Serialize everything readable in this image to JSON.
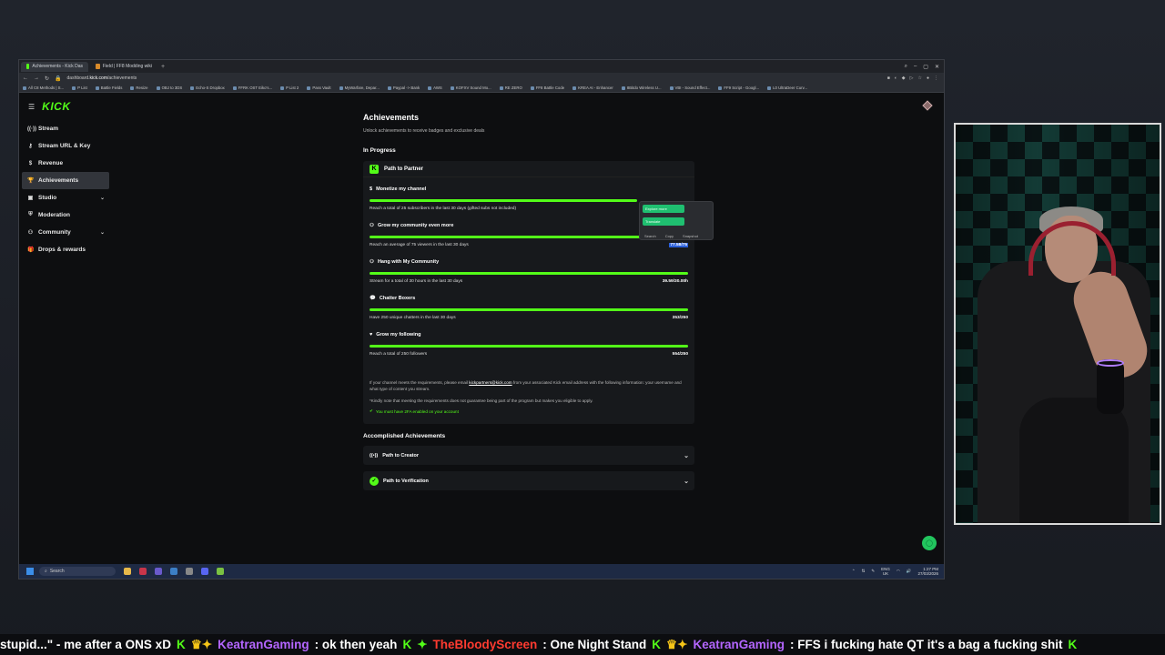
{
  "browser": {
    "tabs": [
      {
        "label": "Achievements - Kick Das"
      },
      {
        "label": "Field | FF8 Modding wiki"
      }
    ],
    "url_prefix": "dashboard.",
    "url_domain": "kick.com",
    "url_path": "/achievements",
    "bookmarks": [
      "All C8 Methods | S...",
      "P List",
      "Battle Fields",
      "Resize",
      "OBJ to 3DS",
      "Echo-S Dropbox",
      "FFRK OST Eiko's...",
      "P List 2",
      "Pass Vault",
      "MyWarfare, Depar...",
      "Paypal -> Bank",
      "AWS",
      "KOFXV Sound Mo...",
      "RE ZERO",
      "FF8 Battle Code",
      "KREA AI - Enhancer",
      "8Bitdo Wireless U...",
      "VBI - Sound Effect...",
      "FF9 Script - Googl...",
      "L0 UltraDeer Curv..."
    ]
  },
  "sidebar": {
    "items": [
      {
        "label": "Stream",
        "icon": "broadcast-icon"
      },
      {
        "label": "Stream URL & Key",
        "icon": "key-icon"
      },
      {
        "label": "Revenue",
        "icon": "dollar-icon"
      },
      {
        "label": "Achievements",
        "icon": "trophy-icon"
      },
      {
        "label": "Studio",
        "icon": "box-icon"
      },
      {
        "label": "Moderation",
        "icon": "shield-icon"
      },
      {
        "label": "Community",
        "icon": "people-icon"
      },
      {
        "label": "Drops & rewards",
        "icon": "gift-icon"
      }
    ]
  },
  "page": {
    "title": "Achievements",
    "subtitle": "Unlock achievements to receive badges and exclusive deals",
    "in_progress": "In Progress",
    "card_title": "Path to Partner",
    "goals": [
      {
        "title": "Monetize my channel",
        "desc": "Reach a total of 25 subscribers in the last 30 days (gifted subs not included)",
        "value": "",
        "progress": 1.0
      },
      {
        "title": "Grow my community even more",
        "desc": "Reach an average of 75 viewers in the last 30 days",
        "value": "77.58/75",
        "progress": 1.0
      },
      {
        "title": "Hang with My Community",
        "desc": "Stream for a total of 30 hours in the last 30 days",
        "value": "39.59/30.00h",
        "progress": 1.0
      },
      {
        "title": "Chatter Boxers",
        "desc": "Have 250 unique chatters in the last 30 days",
        "value": "353/250",
        "progress": 1.0
      },
      {
        "title": "Grow my following",
        "desc": "Reach a total of 250 followers",
        "value": "554/250",
        "progress": 1.0
      }
    ],
    "note_a": "If your channel meets the requirements, please email ",
    "note_email": "kickpartners@kick.com",
    "note_b": " from your associated Kick email address with the following information: your username and what type of content you stream.",
    "note2": "*Kindly note that meeting the requirements does not guarantee being part of the program but makes you eligible to apply.",
    "twofa": "You must have 2FA enabled on your account",
    "accomplished": "Accomplished Achievements",
    "accomplished_items": [
      "Path to Creator",
      "Path to Verification"
    ]
  },
  "context_menu": {
    "explore": "Explore more",
    "translate": "Translate",
    "search": "Search",
    "copy": "Copy",
    "snapshot": "Snapshot"
  },
  "taskbar": {
    "search": "Search",
    "lang": "ENG",
    "region": "UK",
    "time": "1:27 PM",
    "date": "27/03/2026"
  },
  "ticker": {
    "m0": "stupid...\" - me after a ONS xD",
    "u1": "KeatranGaming",
    "m1": ": ok then yeah",
    "u2": "TheBloodyScreen",
    "m2": ": One Night Stand",
    "u3": "KeatranGaming",
    "m3": ": FFS i fucking hate QT it's a bag a fucking shit"
  },
  "colors": {
    "kick_green": "#53fc18",
    "accent_purple": "#b466ff",
    "accent_red": "#ff3b30"
  }
}
